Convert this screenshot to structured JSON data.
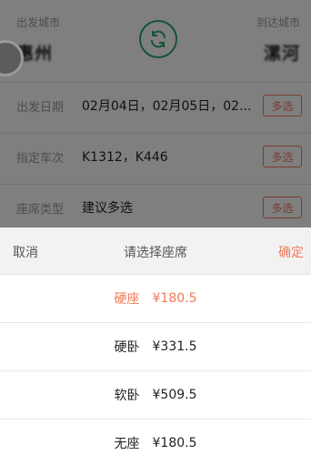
{
  "cities": {
    "from_caption": "出发城市",
    "from_name": "惠州",
    "to_caption": "到达城市",
    "to_name": "漯河"
  },
  "fields": {
    "date_label": "出发日期",
    "date_value": "02月04日，02月05日，02...",
    "train_label": "指定车次",
    "train_value": "K1312，K446",
    "seat_label": "座席类型",
    "seat_value": "建议多选",
    "multi_label": "多选"
  },
  "sheet": {
    "cancel_label": "取消",
    "title": "请选择座席",
    "confirm_label": "确定",
    "seats": [
      {
        "name": "硬座",
        "price": "¥180.5",
        "selected": true
      },
      {
        "name": "硬卧",
        "price": "¥331.5",
        "selected": false
      },
      {
        "name": "软卧",
        "price": "¥509.5",
        "selected": false
      },
      {
        "name": "无座",
        "price": "¥180.5",
        "selected": false
      }
    ]
  },
  "colors": {
    "accent": "#f07a5a",
    "swap_icon": "#2ea86b",
    "overlay": "#000000"
  },
  "icons": {
    "swap": "swap-cities-icon",
    "floating": "floating-assistant-icon"
  }
}
